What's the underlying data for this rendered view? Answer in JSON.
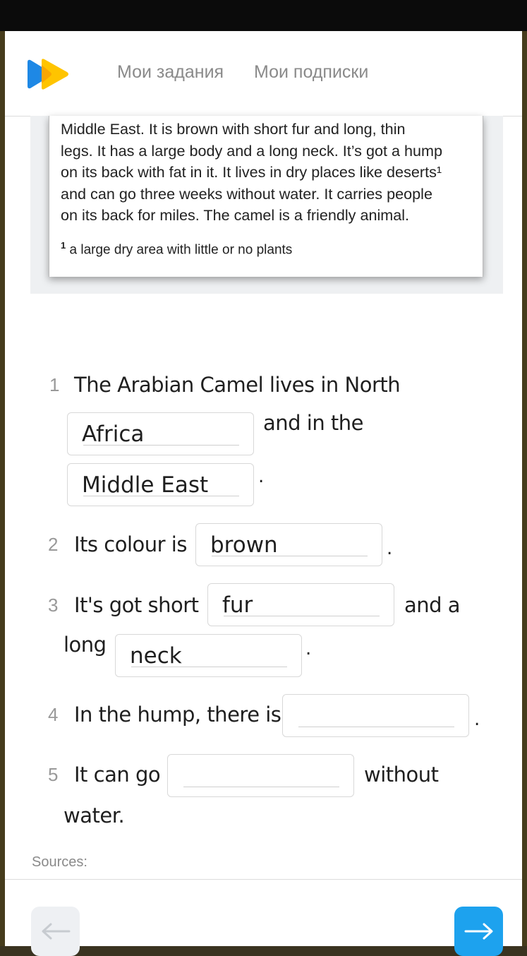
{
  "nav": {
    "links": [
      "Мои задания",
      "Мои подписки"
    ]
  },
  "reading": {
    "lines": [
      "Middle East. It is brown with short fur and long, thin",
      "legs. It has a large body and a long neck. It’s got a hump",
      "on its back with fat in it. It lives in dry places like deserts¹",
      "and can go three weeks without water. It carries people",
      "on its back for miles. The camel is a friendly animal."
    ],
    "footnote_mark": "1",
    "footnote_text": "a large dry area with little or no plants"
  },
  "questions": [
    {
      "num": "1",
      "text_before": "The Arabian Camel lives in North",
      "text_mid": "and in the",
      "answers": [
        "Africa",
        "Middle East"
      ],
      "end": "."
    },
    {
      "num": "2",
      "text_before": "Its colour is",
      "answers": [
        "brown"
      ],
      "end": "."
    },
    {
      "num": "3",
      "text_before": "It's got short",
      "text_mid": "and a",
      "text_line2": "long",
      "answers": [
        "fur",
        "neck"
      ],
      "end": "."
    },
    {
      "num": "4",
      "text_before": "In the hump, there is",
      "answers": [
        ""
      ],
      "end": "."
    },
    {
      "num": "5",
      "text_before": "It can go",
      "text_after": "without",
      "text_line2": "water.",
      "answers": [
        ""
      ]
    }
  ],
  "footer": {
    "sources_label": "Sources:"
  },
  "colors": {
    "accent": "#1da2ee",
    "logo_blue": "#1e88e5",
    "logo_yellow": "#ffc400"
  },
  "icons": [
    "logo-icon",
    "arrow-left-icon",
    "arrow-right-icon"
  ]
}
